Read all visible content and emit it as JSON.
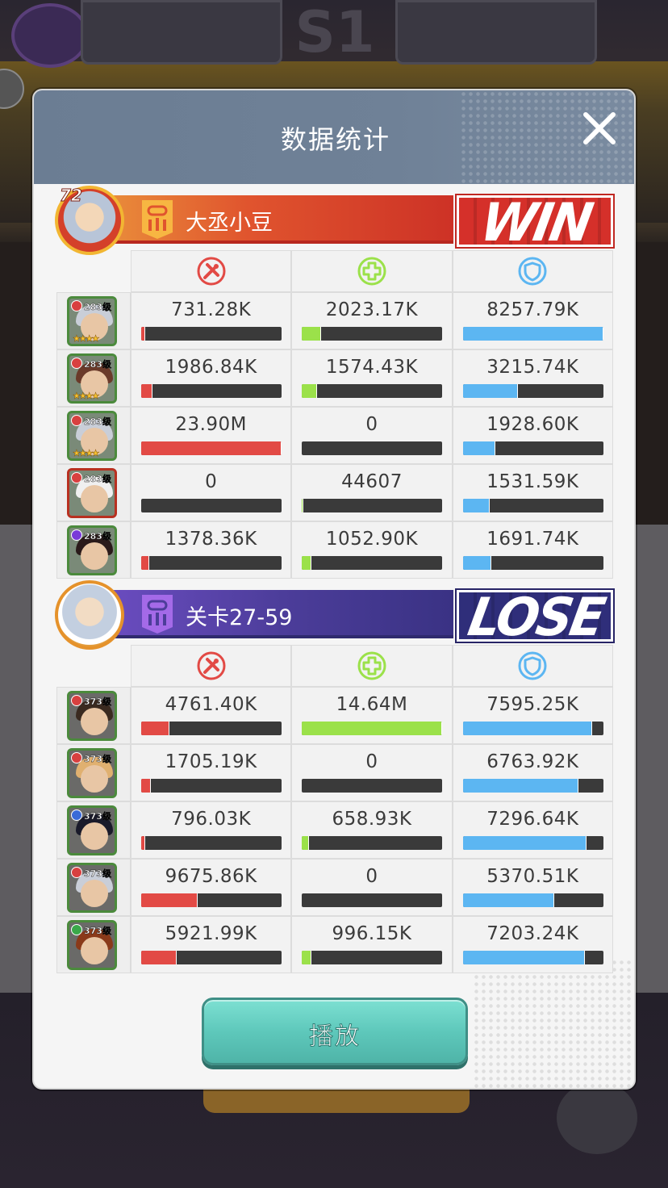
{
  "background": {
    "banner_center": "S1"
  },
  "dialog": {
    "title": "数据统计",
    "close_icon": "close-icon",
    "play_label": "播放"
  },
  "stat_icons": {
    "damage": "damage-icon",
    "heal": "heal-icon",
    "defense": "shield-icon"
  },
  "colors": {
    "damage": "#e24a45",
    "heal": "#9be14a",
    "defense": "#5cb6f2",
    "win": "#d5302a",
    "lose": "#2f2e7a",
    "play_button": "#5ec8bb"
  },
  "teams": [
    {
      "name": "大丞小豆",
      "result": "WIN",
      "leader_level": "72",
      "heroes": [
        {
          "level": "283级",
          "stars": "★★★★",
          "damage": "731.28K",
          "heal": "2023.17K",
          "defense": "8257.79K",
          "damage_ratio": 0.03,
          "heal_ratio": 0.14,
          "defense_ratio": 1.0
        },
        {
          "level": "283级",
          "stars": "★★★★",
          "damage": "1986.84K",
          "heal": "1574.43K",
          "defense": "3215.74K",
          "damage_ratio": 0.08,
          "heal_ratio": 0.11,
          "defense_ratio": 0.39
        },
        {
          "level": "283级",
          "stars": "★★★★",
          "damage": "23.90M",
          "heal": "0",
          "defense": "1928.60K",
          "damage_ratio": 1.0,
          "heal_ratio": 0.0,
          "defense_ratio": 0.23
        },
        {
          "level": "283级",
          "stars": "",
          "damage": "0",
          "heal": "44607",
          "defense": "1531.59K",
          "damage_ratio": 0.0,
          "heal_ratio": 0.01,
          "defense_ratio": 0.19
        },
        {
          "level": "283级",
          "stars": "",
          "damage": "1378.36K",
          "heal": "1052.90K",
          "defense": "1691.74K",
          "damage_ratio": 0.06,
          "heal_ratio": 0.07,
          "defense_ratio": 0.2
        }
      ]
    },
    {
      "name": "关卡27-59",
      "result": "LOSE",
      "leader_level": "",
      "heroes": [
        {
          "level": "373级",
          "stars": "",
          "damage": "4761.40K",
          "heal": "14.64M",
          "defense": "7595.25K",
          "damage_ratio": 0.2,
          "heal_ratio": 1.0,
          "defense_ratio": 0.92
        },
        {
          "level": "373级",
          "stars": "",
          "damage": "1705.19K",
          "heal": "0",
          "defense": "6763.92K",
          "damage_ratio": 0.07,
          "heal_ratio": 0.0,
          "defense_ratio": 0.82
        },
        {
          "level": "373级",
          "stars": "",
          "damage": "796.03K",
          "heal": "658.93K",
          "defense": "7296.64K",
          "damage_ratio": 0.03,
          "heal_ratio": 0.05,
          "defense_ratio": 0.88
        },
        {
          "level": "373级",
          "stars": "",
          "damage": "9675.86K",
          "heal": "0",
          "defense": "5370.51K",
          "damage_ratio": 0.4,
          "heal_ratio": 0.0,
          "defense_ratio": 0.65
        },
        {
          "level": "373级",
          "stars": "",
          "damage": "5921.99K",
          "heal": "996.15K",
          "defense": "7203.24K",
          "damage_ratio": 0.25,
          "heal_ratio": 0.07,
          "defense_ratio": 0.87
        }
      ]
    }
  ]
}
